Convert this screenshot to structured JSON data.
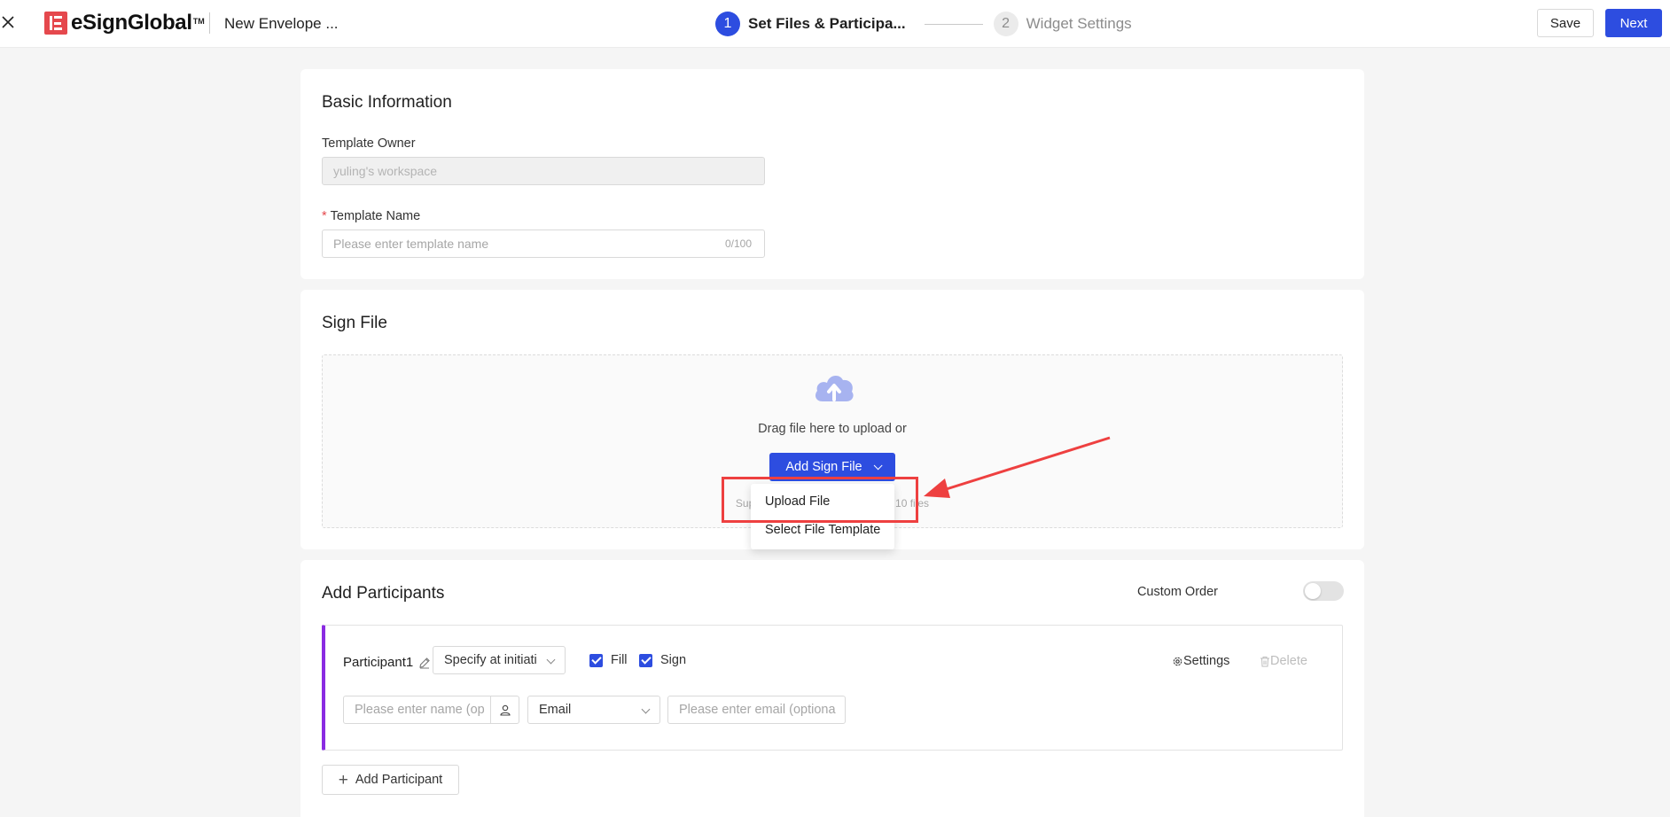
{
  "header": {
    "logo_text": "eSignGlobal",
    "logo_tm": "TM",
    "envelope_title": "New Envelope ...",
    "steps": [
      {
        "num": "1",
        "label": "Set Files & Participa..."
      },
      {
        "num": "2",
        "label": "Widget Settings"
      }
    ],
    "save_label": "Save",
    "next_label": "Next"
  },
  "basic_info": {
    "title": "Basic Information",
    "owner_label": "Template Owner",
    "owner_value": "yuling's workspace",
    "name_required_mark": "*",
    "name_label": "Template Name",
    "name_placeholder": "Please enter template name",
    "name_counter": "0/100"
  },
  "sign_file": {
    "title": "Sign File",
    "drag_text": "Drag file here to upload or",
    "add_button_label": "Add Sign File",
    "supports_text": "Supports pdf, doc... per file, up to 10 files",
    "dropdown_items": [
      "Upload File",
      "Select File Template"
    ]
  },
  "participants": {
    "title": "Add Participants",
    "custom_order_label": "Custom Order",
    "custom_order_on": false,
    "participant": {
      "name": "Participant1",
      "role_value": "Specify at initiati",
      "fill_label": "Fill",
      "sign_label": "Sign",
      "settings_label": "Settings",
      "delete_label": "Delete",
      "name_placeholder": "Please enter name (op",
      "contact_type": "Email",
      "email_placeholder": "Please enter email (optiona"
    },
    "add_button_label": "Add Participant"
  },
  "colors": {
    "primary": "#2d4de0",
    "logo_red": "#e5484d",
    "annotation_red": "#ee4040",
    "participant_accent": "#8a2be2"
  }
}
